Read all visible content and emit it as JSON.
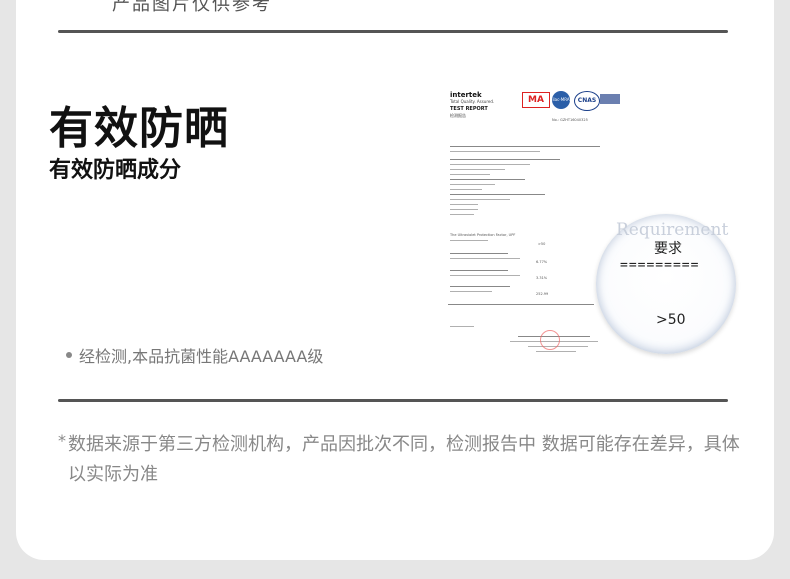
{
  "header": {
    "top_cut_text": "产品图片仅供参考"
  },
  "section": {
    "title": "有效防晒",
    "subtitle": "有效防晒成分",
    "bullet": "经检测,本品抗菌性能AAAAAAA级"
  },
  "report": {
    "brand": "intertek",
    "brand_sub": "Total Quality. Assured.",
    "doc_title": "TEST REPORT",
    "doc_title_cn": "检测报告",
    "ma_label": "MA",
    "ilac_label": "ilac-MRA",
    "cnas_label": "CNAS",
    "report_number": "No.: GZHT16040325",
    "upf_label": "The Ultraviolet Protection Factor, UPF",
    "upf_value": ">50",
    "uva_value": "6.77%",
    "uvb_value": "3.31%",
    "upf_measured": "252.99"
  },
  "magnifier": {
    "watermark": "Requirement",
    "requirement_label": "要求",
    "separator": "=========",
    "value": ">50"
  },
  "footnote": {
    "star": "*",
    "text": "数据来源于第三方检测机构，产品因批次不同，检测报告中 数据可能存在差异，具体以实际为准"
  },
  "colors": {
    "background": "#e6e6e6",
    "card": "#ffffff",
    "rule": "#555555",
    "muted_text": "#888888"
  }
}
